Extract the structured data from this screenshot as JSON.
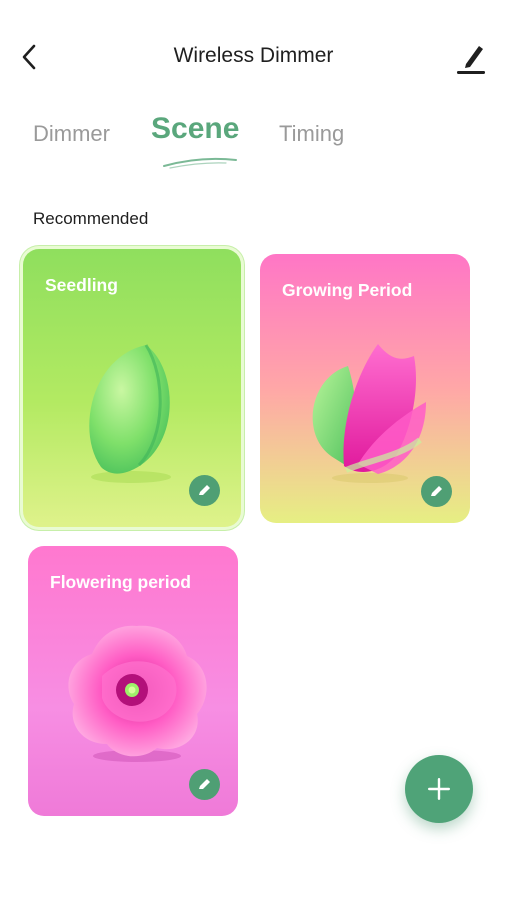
{
  "header": {
    "title": "Wireless Dimmer",
    "back_icon": "chevron-left-icon",
    "edit_icon": "pencil-icon"
  },
  "tabs": [
    {
      "label": "Dimmer",
      "active": false
    },
    {
      "label": "Scene",
      "active": true
    },
    {
      "label": "Timing",
      "active": false
    }
  ],
  "section": {
    "label": "Recommended"
  },
  "cards": [
    {
      "title": "Seedling",
      "selected": true,
      "icon": "seed-icon"
    },
    {
      "title": "Growing Period",
      "selected": false,
      "icon": "bud-icon"
    },
    {
      "title": "Flowering period",
      "selected": false,
      "icon": "flower-icon"
    }
  ],
  "fab": {
    "icon": "plus-icon"
  },
  "colors": {
    "accent": "#4fa378",
    "seedling_top": "#8fdf5e",
    "growing_top": "#ff76c6",
    "flowering_top": "#ff78cf",
    "tab_inactive": "#9a9a9a"
  }
}
